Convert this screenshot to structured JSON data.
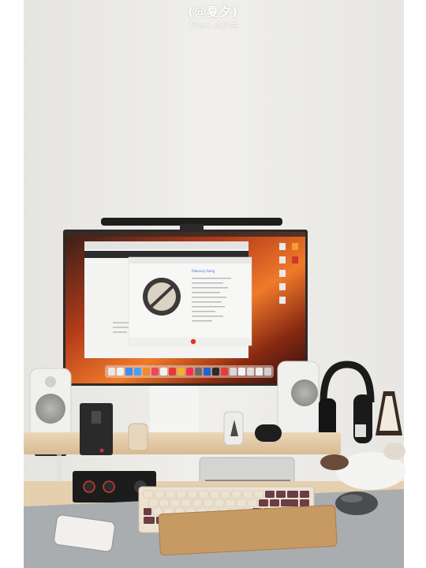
{
  "watermark": {
    "handle": "(@夏夕)",
    "source": "From 小红书"
  },
  "screen": {
    "music_title": "February Song"
  },
  "colors": {
    "wall": "#eeeeea",
    "desk_wood": "#e5cfaf",
    "desk_mat": "#a9adb0",
    "macos_wallpaper_orange": "#e4641e",
    "keycap_maroon": "#6b3d45",
    "keycap_cream": "#ece3d2"
  }
}
